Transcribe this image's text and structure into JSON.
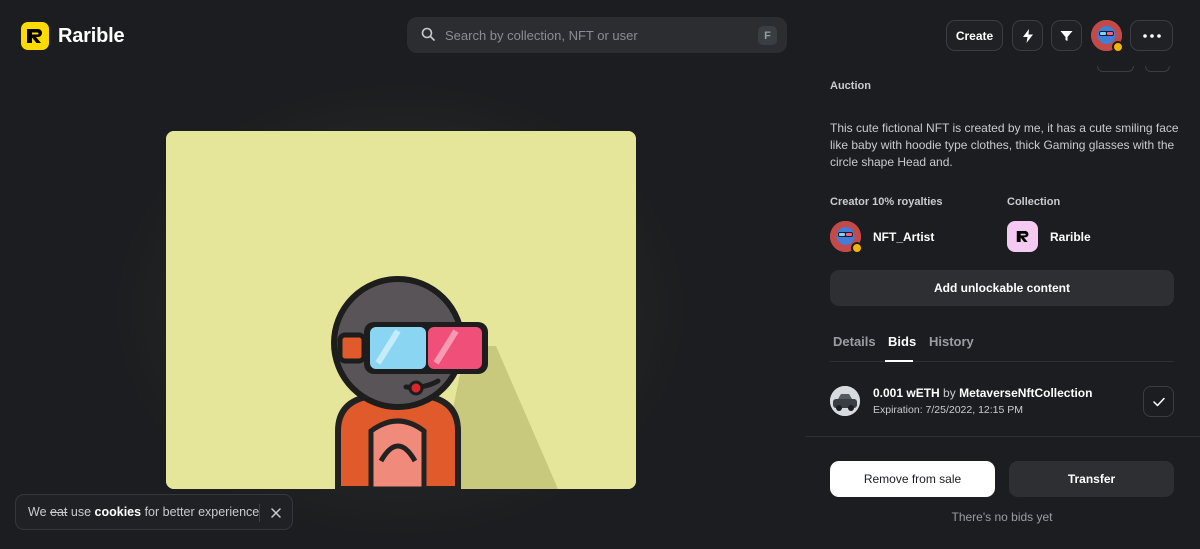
{
  "header": {
    "brand": "Rarible",
    "search_placeholder": "Search by collection, NFT or user",
    "search_shortcut": "F",
    "create_label": "Create"
  },
  "panel": {
    "sale_type": "Auction",
    "description": "This cute fictional NFT is created by me, it has a cute smiling face like baby with hoodie type clothes, thick  Gaming glasses with the circle shape Head and.",
    "creator_label": "Creator 10% royalties",
    "creator_name": "NFT_Artist",
    "collection_label": "Collection",
    "collection_name": "Rarible",
    "unlock_label": "Add unlockable content",
    "tabs": [
      {
        "label": "Details",
        "active": false
      },
      {
        "label": "Bids",
        "active": true
      },
      {
        "label": "History",
        "active": false
      }
    ],
    "bid": {
      "amount": "0.001 wETH",
      "by": "by",
      "bidder": "MetaverseNftCollection",
      "expiration": "Expiration: 7/25/2022, 12:15 PM"
    },
    "remove_label": "Remove from sale",
    "transfer_label": "Transfer",
    "no_bids": "There's no bids yet"
  },
  "cookie": {
    "word1": "We",
    "struck": "eat",
    "word2": "use",
    "bold": "cookies",
    "rest": "for better experience"
  },
  "colors": {
    "background": "#1b1d20",
    "brand_yellow": "#feda03",
    "artwork_bg": "#e5e69a",
    "verified_badge": "#f5b400"
  }
}
